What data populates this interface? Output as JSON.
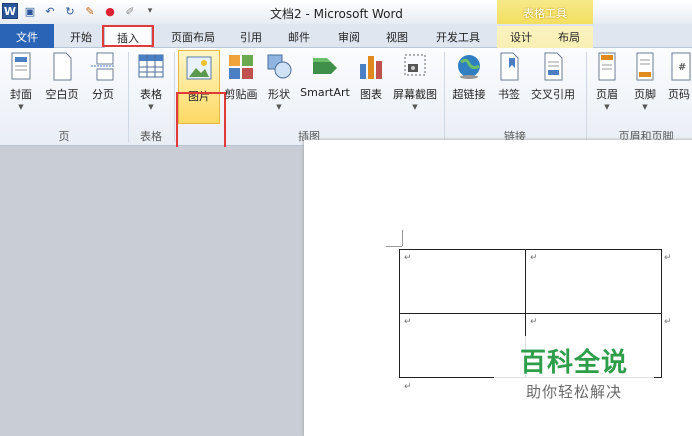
{
  "window": {
    "title": "文档2 - Microsoft Word",
    "context_header": "表格工具"
  },
  "tabs": [
    {
      "label": "文件"
    },
    {
      "label": "开始"
    },
    {
      "label": "插入"
    },
    {
      "label": "页面布局"
    },
    {
      "label": "引用"
    },
    {
      "label": "邮件"
    },
    {
      "label": "审阅"
    },
    {
      "label": "视图"
    },
    {
      "label": "开发工具"
    },
    {
      "label": "设计"
    },
    {
      "label": "布局"
    }
  ],
  "ribbon": {
    "buttons": {
      "cover": "封面",
      "blank_page": "空白页",
      "page_break": "分页",
      "table": "表格",
      "picture": "图片",
      "clipart": "剪贴画",
      "shapes": "形状",
      "smartart": "SmartArt",
      "chart": "图表",
      "screenshot": "屏幕截图",
      "hyperlink": "超链接",
      "bookmark": "书签",
      "cross_ref": "交叉引用",
      "header": "页眉",
      "footer": "页脚",
      "page_num": "页码"
    },
    "groups": {
      "pages": "页",
      "tables": "表格",
      "illustrations": "插图",
      "links": "链接",
      "header_footer": "页眉和页脚"
    }
  },
  "document": {
    "para_mark": "↵"
  },
  "watermark": {
    "main": "百科全说",
    "sub": "助你轻松解决"
  },
  "colors": {
    "file_tab": "#2a64b6",
    "highlight_box": "#e03a3a",
    "watermark_green": "#2e9e4a"
  }
}
